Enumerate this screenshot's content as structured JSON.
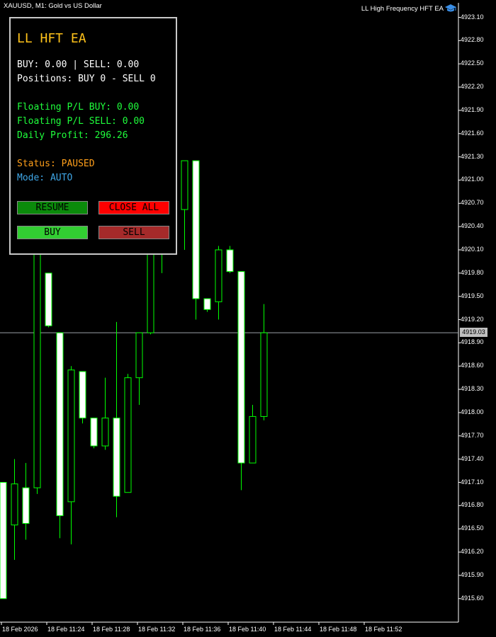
{
  "window": {
    "symbol_title": "XAUUSD, M1:  Gold vs US Dollar",
    "ea_name": "LL High Frequency HFT EA",
    "ea_icon": "graduation-cap-icon"
  },
  "panel": {
    "title": "LL HFT EA",
    "lots_line": "BUY: 0.00 | SELL: 0.00",
    "positions_line": "Positions: BUY 0 - SELL 0",
    "floating_buy": "Floating P/L BUY: 0.00",
    "floating_sell": "Floating P/L SELL: 0.00",
    "daily_profit": "Daily Profit: 296.26",
    "status": "Status: PAUSED",
    "mode": "Mode: AUTO",
    "buttons": {
      "resume": "RESUME",
      "close_all": "CLOSE ALL",
      "buy": "BUY",
      "sell": "SELL"
    }
  },
  "price_axis": [
    "4923.10",
    "4922.80",
    "4922.50",
    "4922.20",
    "4921.90",
    "4921.60",
    "4921.30",
    "4921.00",
    "4920.70",
    "4920.40",
    "4920.10",
    "4919.80",
    "4919.50",
    "4919.20",
    "4918.90",
    "4918.60",
    "4918.30",
    "4918.00",
    "4917.70",
    "4917.40",
    "4917.10",
    "4916.80",
    "4916.50",
    "4916.20",
    "4915.90",
    "4915.60"
  ],
  "current_price": "4919.03",
  "time_axis": [
    "18 Feb 2026",
    "18 Feb 11:24",
    "18 Feb 11:28",
    "18 Feb 11:32",
    "18 Feb 11:36",
    "18 Feb 11:40",
    "18 Feb 11:44",
    "18 Feb 11:48",
    "18 Feb 11:52"
  ],
  "colors": {
    "background": "#000000",
    "candle_outline": "#00ff00",
    "bull_body": "#000000",
    "bear_body": "#ffffff",
    "bid_line": "#9aa0a6",
    "title_color": "#ffc21a",
    "pl_color": "#1fff3c",
    "status_color": "#ff9f1a",
    "mode_color": "#3fa6e6"
  },
  "chart_data": {
    "type": "candlestick",
    "symbol": "XAUUSD",
    "timeframe": "M1",
    "ylim": [
      4915.3,
      4923.2
    ],
    "current_price": 4919.03,
    "candles": [
      {
        "o": 4917.1,
        "h": 4917.1,
        "l": 4915.6,
        "c": 4915.6
      },
      {
        "o": 4916.55,
        "h": 4917.4,
        "l": 4916.1,
        "c": 4917.08
      },
      {
        "o": 4917.03,
        "h": 4917.35,
        "l": 4916.36,
        "c": 4916.57
      },
      {
        "o": 4917.03,
        "h": 4920.15,
        "l": 4916.95,
        "c": 4920.1
      },
      {
        "o": 4919.8,
        "h": 4919.8,
        "l": 4919.1,
        "c": 4919.12
      },
      {
        "o": 4919.03,
        "h": 4919.03,
        "l": 4916.38,
        "c": 4916.67
      },
      {
        "o": 4916.85,
        "h": 4918.6,
        "l": 4916.3,
        "c": 4918.55
      },
      {
        "o": 4918.53,
        "h": 4918.53,
        "l": 4917.86,
        "c": 4917.93
      },
      {
        "o": 4917.93,
        "h": 4917.93,
        "l": 4917.54,
        "c": 4917.57
      },
      {
        "o": 4917.57,
        "h": 4918.45,
        "l": 4917.52,
        "c": 4917.93
      },
      {
        "o": 4917.93,
        "h": 4919.17,
        "l": 4916.65,
        "c": 4916.92
      },
      {
        "o": 4916.97,
        "h": 4918.5,
        "l": 4916.97,
        "c": 4918.45
      },
      {
        "o": 4918.45,
        "h": 4919.03,
        "l": 4918.1,
        "c": 4919.03
      },
      {
        "o": 4919.03,
        "h": 4920.15,
        "l": 4919.01,
        "c": 4920.1
      },
      {
        "o": 4920.08,
        "h": 4920.4,
        "l": 4919.8,
        "c": 4920.3
      },
      {
        "o": 4920.3,
        "h": 4920.65,
        "l": 4920.1,
        "c": 4920.62
      },
      {
        "o": 4920.62,
        "h": 4921.25,
        "l": 4920.1,
        "c": 4921.25
      },
      {
        "o": 4921.25,
        "h": 4921.25,
        "l": 4919.2,
        "c": 4919.47
      },
      {
        "o": 4919.47,
        "h": 4919.47,
        "l": 4919.3,
        "c": 4919.33
      },
      {
        "o": 4919.43,
        "h": 4920.15,
        "l": 4919.2,
        "c": 4920.1
      },
      {
        "o": 4920.1,
        "h": 4920.15,
        "l": 4919.8,
        "c": 4919.82
      },
      {
        "o": 4919.82,
        "h": 4919.82,
        "l": 4917.0,
        "c": 4917.35
      },
      {
        "o": 4917.35,
        "h": 4918.1,
        "l": 4917.35,
        "c": 4917.95
      },
      {
        "o": 4917.95,
        "h": 4919.4,
        "l": 4917.9,
        "c": 4919.03
      }
    ]
  }
}
